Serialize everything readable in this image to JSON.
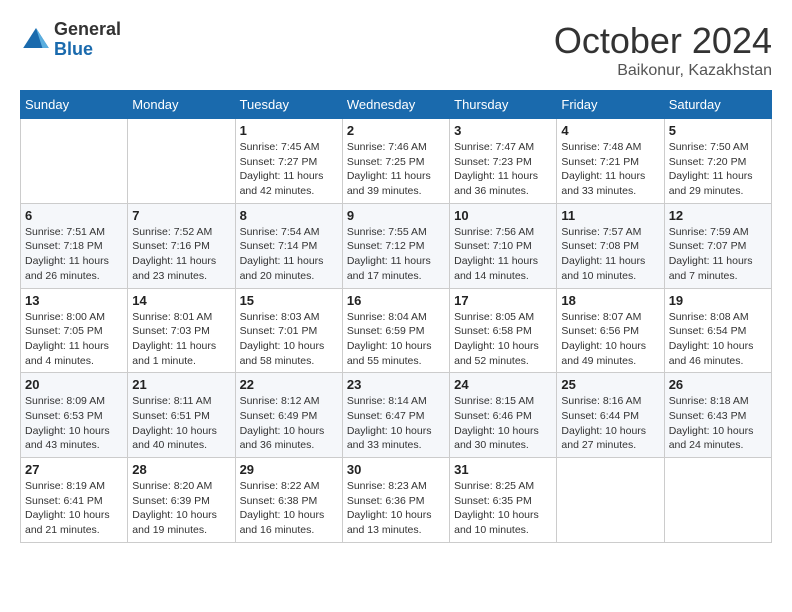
{
  "logo": {
    "general": "General",
    "blue": "Blue"
  },
  "title": "October 2024",
  "location": "Baikonur, Kazakhstan",
  "headers": [
    "Sunday",
    "Monday",
    "Tuesday",
    "Wednesday",
    "Thursday",
    "Friday",
    "Saturday"
  ],
  "weeks": [
    [
      {
        "day": "",
        "info": ""
      },
      {
        "day": "",
        "info": ""
      },
      {
        "day": "1",
        "info": "Sunrise: 7:45 AM\nSunset: 7:27 PM\nDaylight: 11 hours and 42 minutes."
      },
      {
        "day": "2",
        "info": "Sunrise: 7:46 AM\nSunset: 7:25 PM\nDaylight: 11 hours and 39 minutes."
      },
      {
        "day": "3",
        "info": "Sunrise: 7:47 AM\nSunset: 7:23 PM\nDaylight: 11 hours and 36 minutes."
      },
      {
        "day": "4",
        "info": "Sunrise: 7:48 AM\nSunset: 7:21 PM\nDaylight: 11 hours and 33 minutes."
      },
      {
        "day": "5",
        "info": "Sunrise: 7:50 AM\nSunset: 7:20 PM\nDaylight: 11 hours and 29 minutes."
      }
    ],
    [
      {
        "day": "6",
        "info": "Sunrise: 7:51 AM\nSunset: 7:18 PM\nDaylight: 11 hours and 26 minutes."
      },
      {
        "day": "7",
        "info": "Sunrise: 7:52 AM\nSunset: 7:16 PM\nDaylight: 11 hours and 23 minutes."
      },
      {
        "day": "8",
        "info": "Sunrise: 7:54 AM\nSunset: 7:14 PM\nDaylight: 11 hours and 20 minutes."
      },
      {
        "day": "9",
        "info": "Sunrise: 7:55 AM\nSunset: 7:12 PM\nDaylight: 11 hours and 17 minutes."
      },
      {
        "day": "10",
        "info": "Sunrise: 7:56 AM\nSunset: 7:10 PM\nDaylight: 11 hours and 14 minutes."
      },
      {
        "day": "11",
        "info": "Sunrise: 7:57 AM\nSunset: 7:08 PM\nDaylight: 11 hours and 10 minutes."
      },
      {
        "day": "12",
        "info": "Sunrise: 7:59 AM\nSunset: 7:07 PM\nDaylight: 11 hours and 7 minutes."
      }
    ],
    [
      {
        "day": "13",
        "info": "Sunrise: 8:00 AM\nSunset: 7:05 PM\nDaylight: 11 hours and 4 minutes."
      },
      {
        "day": "14",
        "info": "Sunrise: 8:01 AM\nSunset: 7:03 PM\nDaylight: 11 hours and 1 minute."
      },
      {
        "day": "15",
        "info": "Sunrise: 8:03 AM\nSunset: 7:01 PM\nDaylight: 10 hours and 58 minutes."
      },
      {
        "day": "16",
        "info": "Sunrise: 8:04 AM\nSunset: 6:59 PM\nDaylight: 10 hours and 55 minutes."
      },
      {
        "day": "17",
        "info": "Sunrise: 8:05 AM\nSunset: 6:58 PM\nDaylight: 10 hours and 52 minutes."
      },
      {
        "day": "18",
        "info": "Sunrise: 8:07 AM\nSunset: 6:56 PM\nDaylight: 10 hours and 49 minutes."
      },
      {
        "day": "19",
        "info": "Sunrise: 8:08 AM\nSunset: 6:54 PM\nDaylight: 10 hours and 46 minutes."
      }
    ],
    [
      {
        "day": "20",
        "info": "Sunrise: 8:09 AM\nSunset: 6:53 PM\nDaylight: 10 hours and 43 minutes."
      },
      {
        "day": "21",
        "info": "Sunrise: 8:11 AM\nSunset: 6:51 PM\nDaylight: 10 hours and 40 minutes."
      },
      {
        "day": "22",
        "info": "Sunrise: 8:12 AM\nSunset: 6:49 PM\nDaylight: 10 hours and 36 minutes."
      },
      {
        "day": "23",
        "info": "Sunrise: 8:14 AM\nSunset: 6:47 PM\nDaylight: 10 hours and 33 minutes."
      },
      {
        "day": "24",
        "info": "Sunrise: 8:15 AM\nSunset: 6:46 PM\nDaylight: 10 hours and 30 minutes."
      },
      {
        "day": "25",
        "info": "Sunrise: 8:16 AM\nSunset: 6:44 PM\nDaylight: 10 hours and 27 minutes."
      },
      {
        "day": "26",
        "info": "Sunrise: 8:18 AM\nSunset: 6:43 PM\nDaylight: 10 hours and 24 minutes."
      }
    ],
    [
      {
        "day": "27",
        "info": "Sunrise: 8:19 AM\nSunset: 6:41 PM\nDaylight: 10 hours and 21 minutes."
      },
      {
        "day": "28",
        "info": "Sunrise: 8:20 AM\nSunset: 6:39 PM\nDaylight: 10 hours and 19 minutes."
      },
      {
        "day": "29",
        "info": "Sunrise: 8:22 AM\nSunset: 6:38 PM\nDaylight: 10 hours and 16 minutes."
      },
      {
        "day": "30",
        "info": "Sunrise: 8:23 AM\nSunset: 6:36 PM\nDaylight: 10 hours and 13 minutes."
      },
      {
        "day": "31",
        "info": "Sunrise: 8:25 AM\nSunset: 6:35 PM\nDaylight: 10 hours and 10 minutes."
      },
      {
        "day": "",
        "info": ""
      },
      {
        "day": "",
        "info": ""
      }
    ]
  ]
}
